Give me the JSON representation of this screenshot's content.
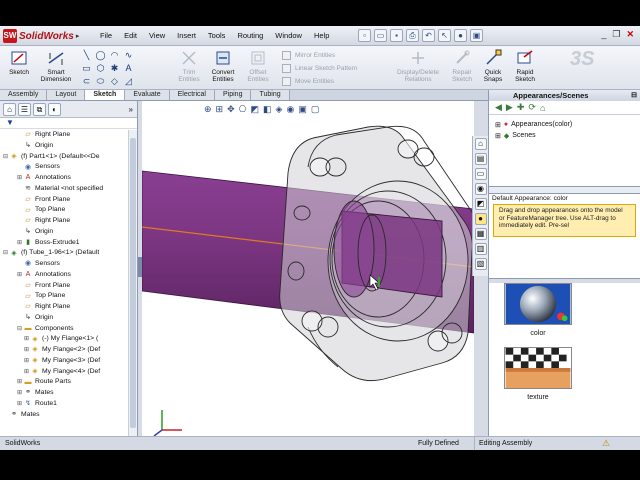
{
  "app": {
    "name": "SolidWorks",
    "logo_mark": "SW",
    "menu": [
      "File",
      "Edit",
      "View",
      "Insert",
      "Tools",
      "Routing",
      "Window",
      "Help"
    ]
  },
  "ribbon": {
    "sketch": "Sketch",
    "smart_dimension_1": "Smart",
    "smart_dimension_2": "Dimension",
    "trim_1": "Trim",
    "trim_2": "Entities",
    "convert_1": "Convert",
    "convert_2": "Entities",
    "offset_1": "Offset",
    "offset_2": "Entities",
    "mirror": "Mirror Entities",
    "linear_pattern": "Linear Sketch Pattern",
    "move": "Move Entities",
    "display_delete_1": "Display/Delete",
    "display_delete_2": "Relations",
    "repair_1": "Repair",
    "repair_2": "Sketch",
    "quick_snaps_1": "Quick",
    "quick_snaps_2": "Snaps",
    "rapid_sketch_1": "Rapid",
    "rapid_sketch_2": "Sketch"
  },
  "tabs": [
    "Assembly",
    "Layout",
    "Sketch",
    "Evaluate",
    "Electrical",
    "Piping",
    "Tubing"
  ],
  "active_tab": "Sketch",
  "tree": [
    {
      "label": "Right Plane",
      "icon": "plane-icon",
      "level": 2
    },
    {
      "label": "Origin",
      "icon": "origin-icon",
      "level": 2
    },
    {
      "label": "(f) Part1<1> (Default<<De",
      "icon": "part-icon",
      "level": 0,
      "toggle": "minus"
    },
    {
      "label": "Sensors",
      "icon": "sensor-icon",
      "level": 2
    },
    {
      "label": "Annotations",
      "icon": "annotation-icon",
      "level": 2,
      "toggle": "plus"
    },
    {
      "label": "Material <not specified",
      "icon": "material-icon",
      "level": 2
    },
    {
      "label": "Front Plane",
      "icon": "plane-icon",
      "level": 2
    },
    {
      "label": "Top Plane",
      "icon": "plane-icon",
      "level": 2
    },
    {
      "label": "Right Plane",
      "icon": "plane-icon",
      "level": 2
    },
    {
      "label": "Origin",
      "icon": "origin-icon",
      "level": 2
    },
    {
      "label": "Boss-Extrude1",
      "icon": "extrude-icon",
      "level": 2,
      "toggle": "plus"
    },
    {
      "label": "(f) Tube_1-96<1> (Default",
      "icon": "tube-icon",
      "level": 0,
      "toggle": "minus"
    },
    {
      "label": "Sensors",
      "icon": "sensor-icon",
      "level": 2
    },
    {
      "label": "Annotations",
      "icon": "annotation-icon",
      "level": 2,
      "toggle": "plus"
    },
    {
      "label": "Front Plane",
      "icon": "plane-icon",
      "level": 2
    },
    {
      "label": "Top Plane",
      "icon": "plane-icon",
      "level": 2
    },
    {
      "label": "Right Plane",
      "icon": "plane-icon",
      "level": 2
    },
    {
      "label": "Origin",
      "icon": "origin-icon",
      "level": 2
    },
    {
      "label": "Components",
      "icon": "folder-icon",
      "level": 2,
      "toggle": "minus"
    },
    {
      "label": "(-) My Flange<1> (",
      "icon": "flange-icon",
      "level": 3,
      "toggle": "plus"
    },
    {
      "label": "My Flange<2> (Def",
      "icon": "flange-icon",
      "level": 3,
      "toggle": "plus"
    },
    {
      "label": "My Flange<3> (Def",
      "icon": "flange-icon",
      "level": 3,
      "toggle": "plus"
    },
    {
      "label": "My Flange<4> (Def",
      "icon": "flange-icon",
      "level": 3,
      "toggle": "plus"
    },
    {
      "label": "Route Parts",
      "icon": "folder-icon",
      "level": 2,
      "toggle": "plus"
    },
    {
      "label": "Mates",
      "icon": "mates-icon",
      "level": 2,
      "toggle": "plus"
    },
    {
      "label": "Route1",
      "icon": "route-icon",
      "level": 2,
      "toggle": "plus"
    },
    {
      "label": "Mates",
      "icon": "mates-icon",
      "level": 0
    }
  ],
  "task_pane": {
    "title": "Appearances/Scenes",
    "tree": [
      {
        "label": "Appearances(color)",
        "icon": "appearance-ball-icon"
      },
      {
        "label": "Scenes",
        "icon": "scenes-icon"
      }
    ],
    "default_appearance": "Default Appearance: color",
    "tooltip": "Drag and drop appearances onto the model or FeatureManager tree.  Use ALT-drag to immediately edit.  Pre-sel",
    "thumbnails": [
      {
        "label": "color",
        "icon": "chrome-sphere-icon"
      },
      {
        "label": "texture",
        "icon": "checker-texture-icon"
      }
    ]
  },
  "status": {
    "app": "SolidWorks",
    "definition": "Fully Defined",
    "mode": "Editing Assembly"
  },
  "colors": {
    "tube": "#7a3580",
    "tube_highlight": "#a35ca8",
    "route_line": "#e07a20",
    "flange_edge": "#2a2a2a",
    "brand": "#c4161c"
  }
}
